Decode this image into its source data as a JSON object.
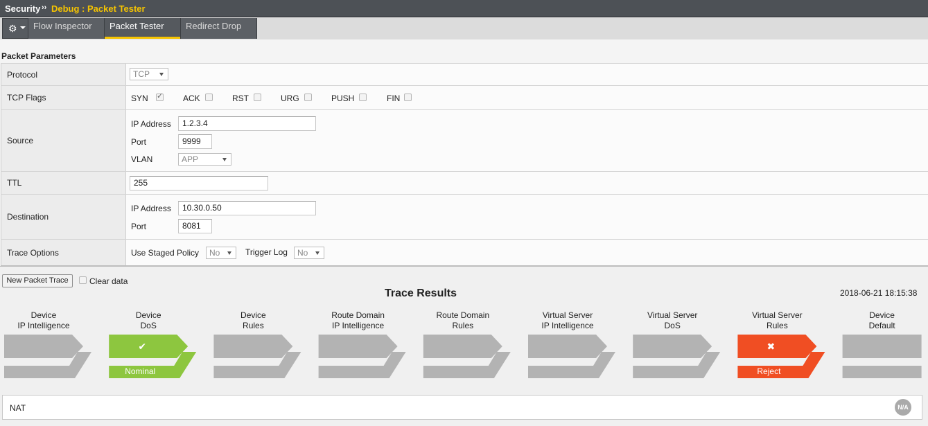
{
  "titlebar": {
    "section": "Security",
    "separator": "››",
    "breadcrumb": "Debug : Packet Tester"
  },
  "tabs": [
    {
      "label": "Flow Inspector",
      "active": false
    },
    {
      "label": "Packet Tester",
      "active": true
    },
    {
      "label": "Redirect Drop",
      "active": false
    }
  ],
  "params": {
    "title": "Packet Parameters",
    "protocol": {
      "label": "Protocol",
      "value": "TCP"
    },
    "tcp_flags": {
      "label": "TCP Flags",
      "flags": [
        {
          "name": "SYN",
          "checked": true
        },
        {
          "name": "ACK",
          "checked": false
        },
        {
          "name": "RST",
          "checked": false
        },
        {
          "name": "URG",
          "checked": false
        },
        {
          "name": "PUSH",
          "checked": false
        },
        {
          "name": "FIN",
          "checked": false
        }
      ]
    },
    "source": {
      "label": "Source",
      "ip_label": "IP Address",
      "ip": "1.2.3.4",
      "port_label": "Port",
      "port": "9999",
      "vlan_label": "VLAN",
      "vlan": "APP"
    },
    "ttl": {
      "label": "TTL",
      "value": "255"
    },
    "destination": {
      "label": "Destination",
      "ip_label": "IP Address",
      "ip": "10.30.0.50",
      "port_label": "Port",
      "port": "8081"
    },
    "trace_options": {
      "label": "Trace Options",
      "staged_label": "Use Staged Policy",
      "staged": "No",
      "trigger_label": "Trigger Log",
      "trigger": "No"
    }
  },
  "actions": {
    "new_trace": "New Packet Trace",
    "clear_data": "Clear data"
  },
  "trace": {
    "title": "Trace Results",
    "timestamp": "2018-06-21 18:15:38",
    "stages": [
      {
        "line1": "Device",
        "line2": "IP Intelligence",
        "status": "none",
        "result": ""
      },
      {
        "line1": "Device",
        "line2": "DoS",
        "status": "ok",
        "result": "Nominal"
      },
      {
        "line1": "Device",
        "line2": "Rules",
        "status": "none",
        "result": ""
      },
      {
        "line1": "Route Domain",
        "line2": "IP Intelligence",
        "status": "none",
        "result": ""
      },
      {
        "line1": "Route Domain",
        "line2": "Rules",
        "status": "none",
        "result": ""
      },
      {
        "line1": "Virtual Server",
        "line2": "IP Intelligence",
        "status": "none",
        "result": ""
      },
      {
        "line1": "Virtual Server",
        "line2": "DoS",
        "status": "none",
        "result": ""
      },
      {
        "line1": "Virtual Server",
        "line2": "Rules",
        "status": "reject",
        "result": "Reject"
      },
      {
        "line1": "Device",
        "line2": "Default",
        "status": "none",
        "result": ""
      }
    ]
  },
  "nat": {
    "label": "NAT",
    "badge": "N/A"
  },
  "colors": {
    "accent": "#f6c400",
    "ok": "#8dc63f",
    "reject": "#f04e23",
    "neutral": "#b3b3b3"
  }
}
